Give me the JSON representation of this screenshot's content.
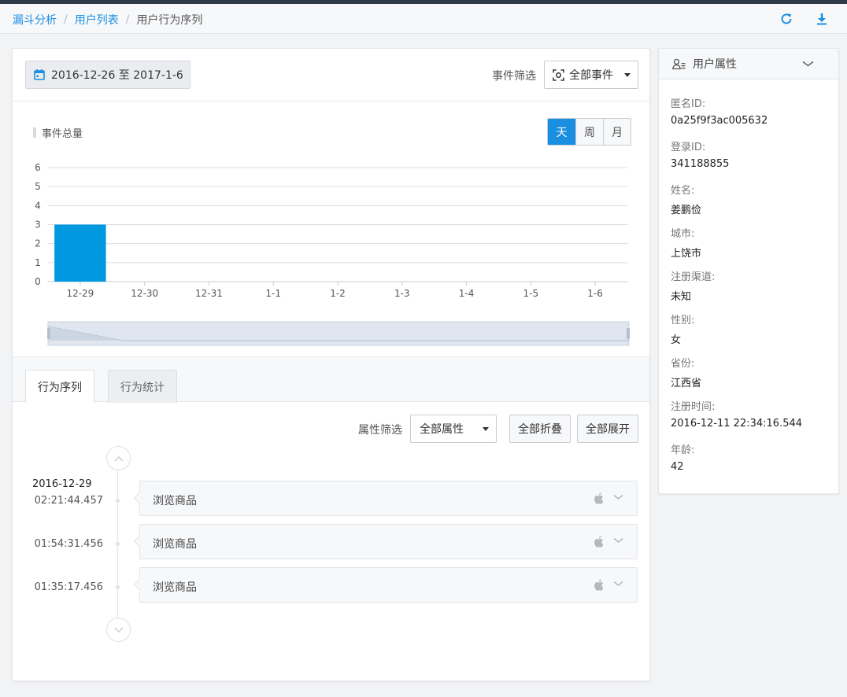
{
  "breadcrumb": {
    "items": [
      "漏斗分析",
      "用户列表"
    ],
    "current": "用户行为序列",
    "separator": "/"
  },
  "header": {
    "refresh_icon": "refresh-icon",
    "download_icon": "download-icon"
  },
  "toolbar": {
    "date_range": "2016-12-26 至 2017-1-6",
    "event_filter_label": "事件筛选",
    "event_filter_value": "全部事件"
  },
  "chart_section": {
    "title": "事件总量",
    "granularity": [
      "天",
      "周",
      "月"
    ],
    "selected_granularity": "天"
  },
  "chart_data": {
    "type": "bar",
    "title": "事件总量",
    "categories": [
      "12-29",
      "12-30",
      "12-31",
      "1-1",
      "1-2",
      "1-3",
      "1-4",
      "1-5",
      "1-6"
    ],
    "values": [
      3,
      0,
      0,
      0,
      0,
      0,
      0,
      0,
      0
    ],
    "ylim": [
      0,
      6
    ],
    "yticks": [
      0,
      1,
      2,
      3,
      4,
      5,
      6
    ],
    "grid": true,
    "bar_color": "#0099e0"
  },
  "tabs": [
    {
      "label": "行为序列",
      "active": true
    },
    {
      "label": "行为统计",
      "active": false
    }
  ],
  "sequence": {
    "attr_filter_label": "属性筛选",
    "attr_filter_value": "全部属性",
    "collapse_all": "全部折叠",
    "expand_all": "全部展开",
    "date": "2016-12-29",
    "events": [
      {
        "time": "02:21:44.457",
        "name": "浏览商品",
        "platform": "apple-icon"
      },
      {
        "time": "01:54:31.456",
        "name": "浏览商品",
        "platform": "apple-icon"
      },
      {
        "time": "01:35:17.456",
        "name": "浏览商品",
        "platform": "apple-icon"
      }
    ]
  },
  "user_props": {
    "title": "用户属性",
    "items": [
      {
        "key": "匿名ID:",
        "value": "0a25f9f3ac005632"
      },
      {
        "key": "登录ID:",
        "value": "341188855"
      },
      {
        "key": "姓名:",
        "value": "姜鹏俭"
      },
      {
        "key": "城市:",
        "value": "上饶市"
      },
      {
        "key": "注册渠道:",
        "value": "未知"
      },
      {
        "key": "性别:",
        "value": "女"
      },
      {
        "key": "省份:",
        "value": "江西省"
      },
      {
        "key": "注册时间:",
        "value": "2016-12-11 22:34:16.544"
      },
      {
        "key": "年龄:",
        "value": "42"
      }
    ]
  },
  "colors": {
    "accent": "#1a8ee0",
    "topbar": "#2f3a4b"
  }
}
